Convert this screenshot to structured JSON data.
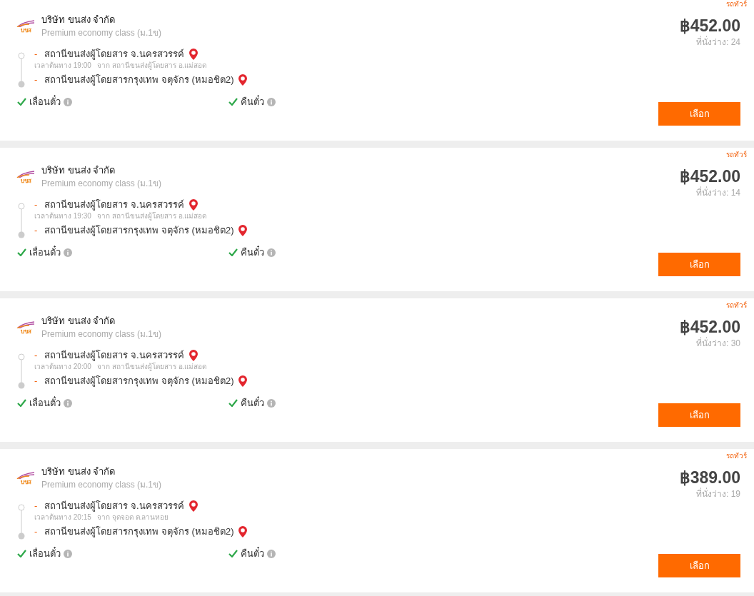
{
  "trips": [
    {
      "badge": "รถทัวร์",
      "logo_text": "บขส",
      "company": "บริษัท ขนส่ง จำกัด",
      "class": "Premium economy class (ม.1ข)",
      "stop_marker": "-",
      "origin": "สถานีขนส่งผู้โดยสาร จ.นครสวรรค์",
      "departure": "เวลาต้นทาง 19:00   จาก สถานีขนส่งผู้โดยสาร อ.แม่สอด",
      "destination": "สถานีขนส่งผู้โดยสารกรุงเทพ จตุจักร (หมอชิต2)",
      "features": [
        {
          "label": "เลื่อนตั๋ว",
          "available": true
        },
        {
          "label": "คืนตั๋ว",
          "available": true
        }
      ],
      "price": "฿452.00",
      "seats": "ที่นั่งว่าง: 24",
      "button": "เลือก"
    },
    {
      "badge": "รถทัวร์",
      "logo_text": "บขส",
      "company": "บริษัท ขนส่ง จำกัด",
      "class": "Premium economy class (ม.1ข)",
      "stop_marker": "-",
      "origin": "สถานีขนส่งผู้โดยสาร จ.นครสวรรค์",
      "departure": "เวลาต้นทาง 19:30   จาก สถานีขนส่งผู้โดยสาร อ.แม่สอด",
      "destination": "สถานีขนส่งผู้โดยสารกรุงเทพ จตุจักร (หมอชิต2)",
      "features": [
        {
          "label": "เลื่อนตั๋ว",
          "available": true
        },
        {
          "label": "คืนตั๋ว",
          "available": true
        }
      ],
      "price": "฿452.00",
      "seats": "ที่นั่งว่าง: 14",
      "button": "เลือก"
    },
    {
      "badge": "รถทัวร์",
      "logo_text": "บขส",
      "company": "บริษัท ขนส่ง จำกัด",
      "class": "Premium economy class (ม.1ข)",
      "stop_marker": "-",
      "origin": "สถานีขนส่งผู้โดยสาร จ.นครสวรรค์",
      "departure": "เวลาต้นทาง 20:00   จาก สถานีขนส่งผู้โดยสาร อ.แม่สอด",
      "destination": "สถานีขนส่งผู้โดยสารกรุงเทพ จตุจักร (หมอชิต2)",
      "features": [
        {
          "label": "เลื่อนตั๋ว",
          "available": true
        },
        {
          "label": "คืนตั๋ว",
          "available": true
        }
      ],
      "price": "฿452.00",
      "seats": "ที่นั่งว่าง: 30",
      "button": "เลือก"
    },
    {
      "badge": "รถทัวร์",
      "logo_text": "บขส",
      "company": "บริษัท ขนส่ง จำกัด",
      "class": "Premium economy class (ม.1ข)",
      "stop_marker": "-",
      "origin": "สถานีขนส่งผู้โดยสาร จ.นครสวรรค์",
      "departure": "เวลาต้นทาง 20:15   จาก จุดจอด ต.ลานหอย",
      "destination": "สถานีขนส่งผู้โดยสารกรุงเทพ จตุจักร (หมอชิต2)",
      "features": [
        {
          "label": "เลื่อนตั๋ว",
          "available": true
        },
        {
          "label": "คืนตั๋ว",
          "available": true
        }
      ],
      "price": "฿389.00",
      "seats": "ที่นั่งว่าง: 19",
      "button": "เลือก"
    }
  ]
}
